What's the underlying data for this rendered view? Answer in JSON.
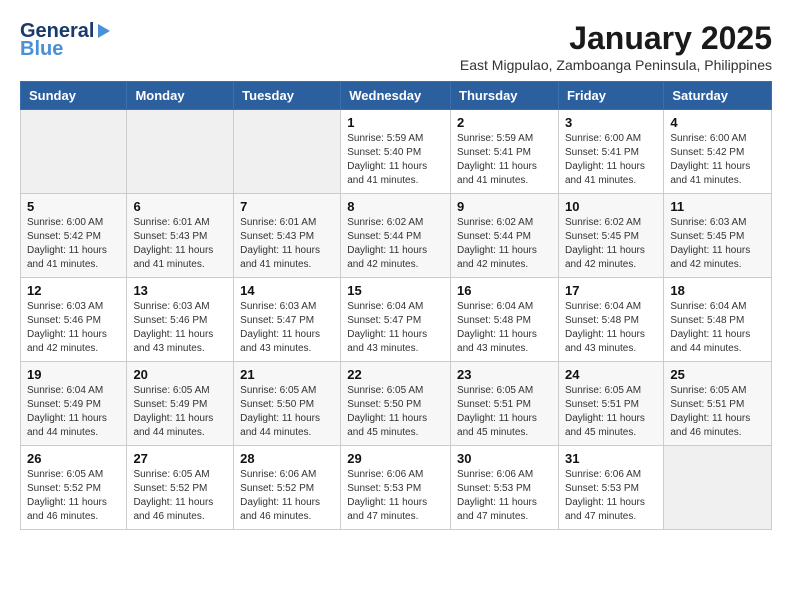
{
  "header": {
    "logo_line1": "General",
    "logo_line2": "Blue",
    "month_title": "January 2025",
    "location": "East Migpulao, Zamboanga Peninsula, Philippines"
  },
  "weekdays": [
    "Sunday",
    "Monday",
    "Tuesday",
    "Wednesday",
    "Thursday",
    "Friday",
    "Saturday"
  ],
  "weeks": [
    [
      {
        "day": "",
        "info": ""
      },
      {
        "day": "",
        "info": ""
      },
      {
        "day": "",
        "info": ""
      },
      {
        "day": "1",
        "info": "Sunrise: 5:59 AM\nSunset: 5:40 PM\nDaylight: 11 hours\nand 41 minutes."
      },
      {
        "day": "2",
        "info": "Sunrise: 5:59 AM\nSunset: 5:41 PM\nDaylight: 11 hours\nand 41 minutes."
      },
      {
        "day": "3",
        "info": "Sunrise: 6:00 AM\nSunset: 5:41 PM\nDaylight: 11 hours\nand 41 minutes."
      },
      {
        "day": "4",
        "info": "Sunrise: 6:00 AM\nSunset: 5:42 PM\nDaylight: 11 hours\nand 41 minutes."
      }
    ],
    [
      {
        "day": "5",
        "info": "Sunrise: 6:00 AM\nSunset: 5:42 PM\nDaylight: 11 hours\nand 41 minutes."
      },
      {
        "day": "6",
        "info": "Sunrise: 6:01 AM\nSunset: 5:43 PM\nDaylight: 11 hours\nand 41 minutes."
      },
      {
        "day": "7",
        "info": "Sunrise: 6:01 AM\nSunset: 5:43 PM\nDaylight: 11 hours\nand 41 minutes."
      },
      {
        "day": "8",
        "info": "Sunrise: 6:02 AM\nSunset: 5:44 PM\nDaylight: 11 hours\nand 42 minutes."
      },
      {
        "day": "9",
        "info": "Sunrise: 6:02 AM\nSunset: 5:44 PM\nDaylight: 11 hours\nand 42 minutes."
      },
      {
        "day": "10",
        "info": "Sunrise: 6:02 AM\nSunset: 5:45 PM\nDaylight: 11 hours\nand 42 minutes."
      },
      {
        "day": "11",
        "info": "Sunrise: 6:03 AM\nSunset: 5:45 PM\nDaylight: 11 hours\nand 42 minutes."
      }
    ],
    [
      {
        "day": "12",
        "info": "Sunrise: 6:03 AM\nSunset: 5:46 PM\nDaylight: 11 hours\nand 42 minutes."
      },
      {
        "day": "13",
        "info": "Sunrise: 6:03 AM\nSunset: 5:46 PM\nDaylight: 11 hours\nand 43 minutes."
      },
      {
        "day": "14",
        "info": "Sunrise: 6:03 AM\nSunset: 5:47 PM\nDaylight: 11 hours\nand 43 minutes."
      },
      {
        "day": "15",
        "info": "Sunrise: 6:04 AM\nSunset: 5:47 PM\nDaylight: 11 hours\nand 43 minutes."
      },
      {
        "day": "16",
        "info": "Sunrise: 6:04 AM\nSunset: 5:48 PM\nDaylight: 11 hours\nand 43 minutes."
      },
      {
        "day": "17",
        "info": "Sunrise: 6:04 AM\nSunset: 5:48 PM\nDaylight: 11 hours\nand 43 minutes."
      },
      {
        "day": "18",
        "info": "Sunrise: 6:04 AM\nSunset: 5:48 PM\nDaylight: 11 hours\nand 44 minutes."
      }
    ],
    [
      {
        "day": "19",
        "info": "Sunrise: 6:04 AM\nSunset: 5:49 PM\nDaylight: 11 hours\nand 44 minutes."
      },
      {
        "day": "20",
        "info": "Sunrise: 6:05 AM\nSunset: 5:49 PM\nDaylight: 11 hours\nand 44 minutes."
      },
      {
        "day": "21",
        "info": "Sunrise: 6:05 AM\nSunset: 5:50 PM\nDaylight: 11 hours\nand 44 minutes."
      },
      {
        "day": "22",
        "info": "Sunrise: 6:05 AM\nSunset: 5:50 PM\nDaylight: 11 hours\nand 45 minutes."
      },
      {
        "day": "23",
        "info": "Sunrise: 6:05 AM\nSunset: 5:51 PM\nDaylight: 11 hours\nand 45 minutes."
      },
      {
        "day": "24",
        "info": "Sunrise: 6:05 AM\nSunset: 5:51 PM\nDaylight: 11 hours\nand 45 minutes."
      },
      {
        "day": "25",
        "info": "Sunrise: 6:05 AM\nSunset: 5:51 PM\nDaylight: 11 hours\nand 46 minutes."
      }
    ],
    [
      {
        "day": "26",
        "info": "Sunrise: 6:05 AM\nSunset: 5:52 PM\nDaylight: 11 hours\nand 46 minutes."
      },
      {
        "day": "27",
        "info": "Sunrise: 6:05 AM\nSunset: 5:52 PM\nDaylight: 11 hours\nand 46 minutes."
      },
      {
        "day": "28",
        "info": "Sunrise: 6:06 AM\nSunset: 5:52 PM\nDaylight: 11 hours\nand 46 minutes."
      },
      {
        "day": "29",
        "info": "Sunrise: 6:06 AM\nSunset: 5:53 PM\nDaylight: 11 hours\nand 47 minutes."
      },
      {
        "day": "30",
        "info": "Sunrise: 6:06 AM\nSunset: 5:53 PM\nDaylight: 11 hours\nand 47 minutes."
      },
      {
        "day": "31",
        "info": "Sunrise: 6:06 AM\nSunset: 5:53 PM\nDaylight: 11 hours\nand 47 minutes."
      },
      {
        "day": "",
        "info": ""
      }
    ]
  ]
}
